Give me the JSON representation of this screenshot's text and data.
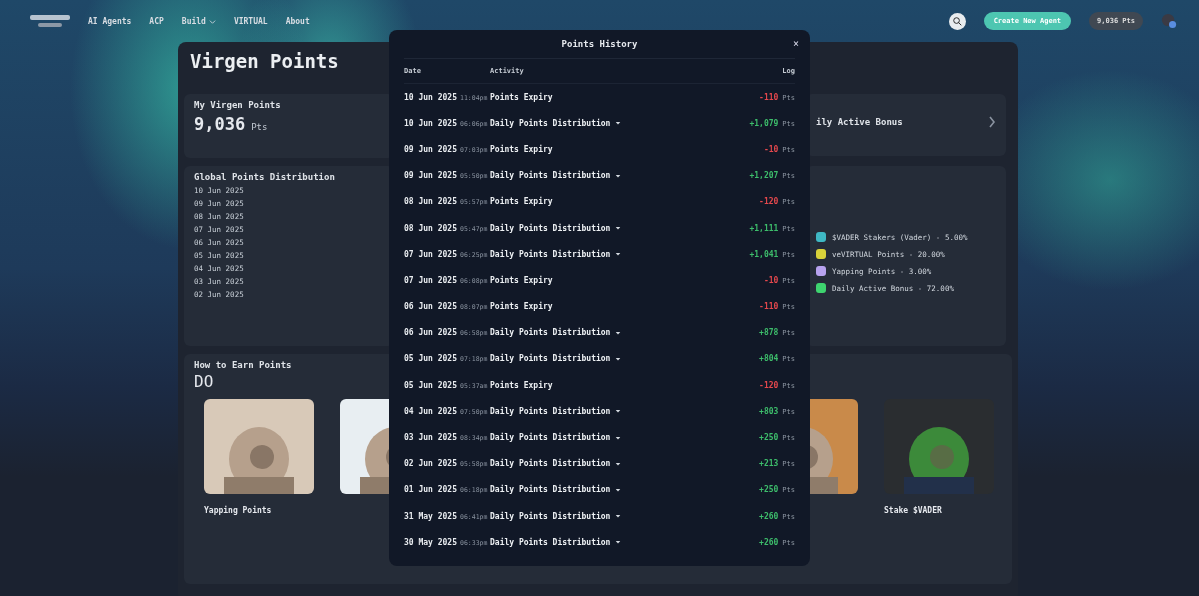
{
  "nav": {
    "items": [
      {
        "label": "AI Agents",
        "dropdown": false
      },
      {
        "label": "ACP",
        "dropdown": false
      },
      {
        "label": "Build",
        "dropdown": true
      },
      {
        "label": "VIRTUAL",
        "dropdown": false
      },
      {
        "label": "About",
        "dropdown": false
      }
    ],
    "create_button": "Create New Agent",
    "points_button": "9,036 Pts"
  },
  "page": {
    "title": "Virgen Points",
    "my_points": {
      "title": "My Virgen Points",
      "value": "9,036",
      "unit": "Pts"
    },
    "bonus_card": {
      "title": "ily Active Bonus"
    },
    "distribution": {
      "title": "Global Points Distribution",
      "dates": [
        "10 Jun 2025",
        "09 Jun 2025",
        "08 Jun 2025",
        "07 Jun 2025",
        "06 Jun 2025",
        "05 Jun 2025",
        "04 Jun 2025",
        "03 Jun 2025",
        "02 Jun 2025"
      ]
    },
    "legend": [
      {
        "label": "$VADER Stakers (Vader) - 5.00%",
        "color": "#3fb8c4"
      },
      {
        "label": "veVIRTUAL Points - 20.00%",
        "color": "#d8d23a"
      },
      {
        "label": "Yapping Points - 3.00%",
        "color": "#b7a2ee"
      },
      {
        "label": "Daily Active Bonus - 72.00%",
        "color": "#3ed46f"
      }
    ],
    "earn": {
      "title": "How to Earn Points",
      "subtitle": "DO",
      "cards": [
        {
          "kind": "picture",
          "title": "Yapping Points"
        },
        {
          "kind": "picture"
        },
        {
          "kind": "picture"
        },
        {
          "kind": "picture",
          "title": "Stake $VADER"
        }
      ]
    }
  },
  "modal": {
    "title": "Points History",
    "close": "×",
    "columns": [
      "Date",
      "Activity",
      "Log"
    ],
    "rows": [
      {
        "date": "10 Jun 2025",
        "time": "11:04pm",
        "activity": "Points Expiry",
        "expandable": false,
        "amount": "-110",
        "kind": "loss",
        "unit": "Pts"
      },
      {
        "date": "10 Jun 2025",
        "time": "06:06pm",
        "activity": "Daily Points Distribution",
        "expandable": true,
        "amount": "+1,079",
        "kind": "gain",
        "unit": "Pts"
      },
      {
        "date": "09 Jun 2025",
        "time": "07:03pm",
        "activity": "Points Expiry",
        "expandable": false,
        "amount": "-10",
        "kind": "loss",
        "unit": "Pts"
      },
      {
        "date": "09 Jun 2025",
        "time": "05:50pm",
        "activity": "Daily Points Distribution",
        "expandable": true,
        "amount": "+1,207",
        "kind": "gain",
        "unit": "Pts"
      },
      {
        "date": "08 Jun 2025",
        "time": "05:57pm",
        "activity": "Points Expiry",
        "expandable": false,
        "amount": "-120",
        "kind": "loss",
        "unit": "Pts"
      },
      {
        "date": "08 Jun 2025",
        "time": "05:47pm",
        "activity": "Daily Points Distribution",
        "expandable": true,
        "amount": "+1,111",
        "kind": "gain",
        "unit": "Pts"
      },
      {
        "date": "07 Jun 2025",
        "time": "06:25pm",
        "activity": "Daily Points Distribution",
        "expandable": true,
        "amount": "+1,041",
        "kind": "gain",
        "unit": "Pts"
      },
      {
        "date": "07 Jun 2025",
        "time": "06:08pm",
        "activity": "Points Expiry",
        "expandable": false,
        "amount": "-10",
        "kind": "loss",
        "unit": "Pts"
      },
      {
        "date": "06 Jun 2025",
        "time": "08:07pm",
        "activity": "Points Expiry",
        "expandable": false,
        "amount": "-110",
        "kind": "loss",
        "unit": "Pts"
      },
      {
        "date": "06 Jun 2025",
        "time": "06:58pm",
        "activity": "Daily Points Distribution",
        "expandable": true,
        "amount": "+878",
        "kind": "gain",
        "unit": "Pts"
      },
      {
        "date": "05 Jun 2025",
        "time": "07:18pm",
        "activity": "Daily Points Distribution",
        "expandable": true,
        "amount": "+804",
        "kind": "gain",
        "unit": "Pts"
      },
      {
        "date": "05 Jun 2025",
        "time": "05:37am",
        "activity": "Points Expiry",
        "expandable": false,
        "amount": "-120",
        "kind": "loss",
        "unit": "Pts"
      },
      {
        "date": "04 Jun 2025",
        "time": "07:50pm",
        "activity": "Daily Points Distribution",
        "expandable": true,
        "amount": "+803",
        "kind": "gain",
        "unit": "Pts"
      },
      {
        "date": "03 Jun 2025",
        "time": "08:34pm",
        "activity": "Daily Points Distribution",
        "expandable": true,
        "amount": "+250",
        "kind": "gain",
        "unit": "Pts"
      },
      {
        "date": "02 Jun 2025",
        "time": "05:58pm",
        "activity": "Daily Points Distribution",
        "expandable": true,
        "amount": "+213",
        "kind": "gain",
        "unit": "Pts"
      },
      {
        "date": "01 Jun 2025",
        "time": "06:18pm",
        "activity": "Daily Points Distribution",
        "expandable": true,
        "amount": "+250",
        "kind": "gain",
        "unit": "Pts"
      },
      {
        "date": "31 May 2025",
        "time": "06:41pm",
        "activity": "Daily Points Distribution",
        "expandable": true,
        "amount": "+260",
        "kind": "gain",
        "unit": "Pts"
      },
      {
        "date": "30 May 2025",
        "time": "06:33pm",
        "activity": "Daily Points Distribution",
        "expandable": true,
        "amount": "+260",
        "kind": "gain",
        "unit": "Pts"
      }
    ]
  }
}
